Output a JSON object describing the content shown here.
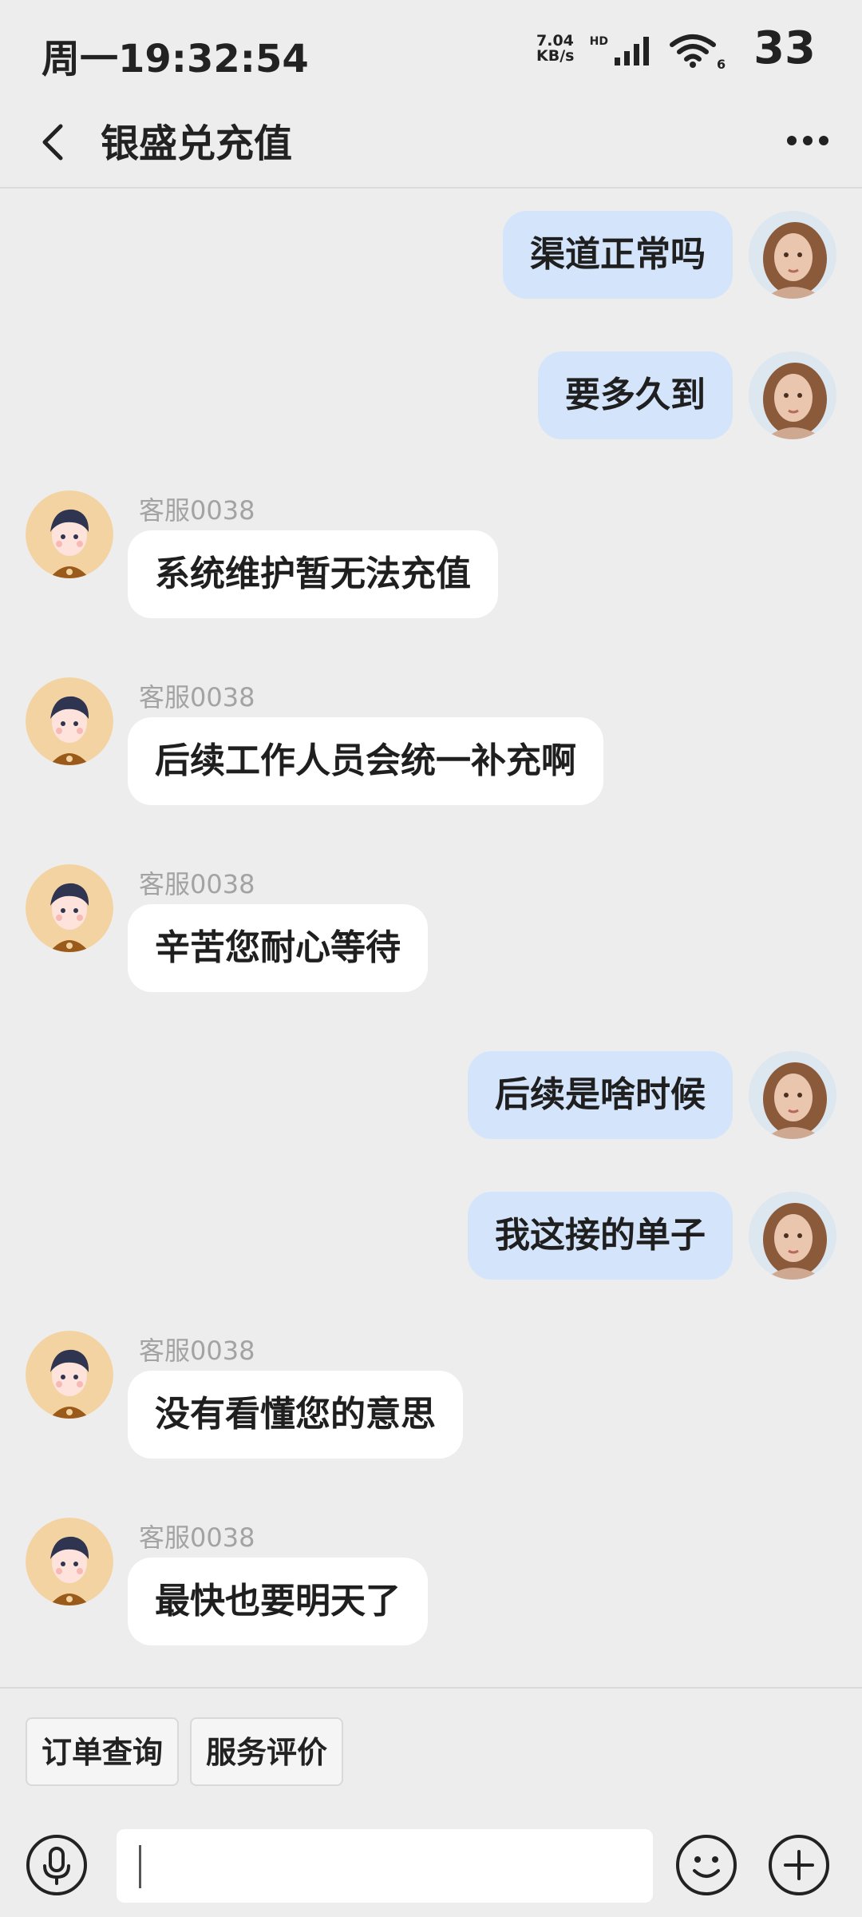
{
  "status_bar": {
    "time": "周一19:32:54",
    "net_speed_value": "7.04",
    "net_speed_unit": "KB/s",
    "hd_label": "HD",
    "wifi_badge": "6",
    "battery": "33"
  },
  "header": {
    "title": "银盛兑充值"
  },
  "messages": [
    {
      "side": "out",
      "text": "渠道正常吗"
    },
    {
      "side": "out",
      "text": "要多久到"
    },
    {
      "side": "in",
      "sender": "客服0038",
      "text": "系统维护暂无法充值"
    },
    {
      "side": "in",
      "sender": "客服0038",
      "text": "后续工作人员会统一补充啊"
    },
    {
      "side": "in",
      "sender": "客服0038",
      "text": "辛苦您耐心等待"
    },
    {
      "side": "out",
      "text": "后续是啥时候"
    },
    {
      "side": "out",
      "text": "我这接的单子"
    },
    {
      "side": "in",
      "sender": "客服0038",
      "text": "没有看懂您的意思"
    },
    {
      "side": "in",
      "sender": "客服0038",
      "text": "最快也要明天了"
    }
  ],
  "quick_actions": {
    "order_query": "订单查询",
    "service_rating": "服务评价"
  },
  "input": {
    "value": ""
  },
  "colors": {
    "outgoing_bubble": "#d4e5fb",
    "incoming_bubble": "#ffffff",
    "background": "#ededed"
  }
}
